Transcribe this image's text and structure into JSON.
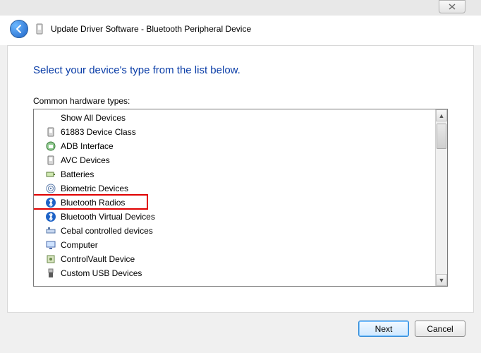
{
  "window": {
    "title": "Update Driver Software - Bluetooth Peripheral Device"
  },
  "instruction": "Select your device's type from the list below.",
  "list_label": "Common hardware types:",
  "items": [
    {
      "label": "Show All Devices",
      "icon": ""
    },
    {
      "label": "61883 Device Class",
      "icon": "device"
    },
    {
      "label": "ADB Interface",
      "icon": "adb"
    },
    {
      "label": "AVC Devices",
      "icon": "device"
    },
    {
      "label": "Batteries",
      "icon": "battery"
    },
    {
      "label": "Biometric Devices",
      "icon": "biometric"
    },
    {
      "label": "Bluetooth Radios",
      "icon": "bluetooth"
    },
    {
      "label": "Bluetooth Virtual Devices",
      "icon": "bluetooth"
    },
    {
      "label": "Cebal controlled devices",
      "icon": "cebal"
    },
    {
      "label": "Computer",
      "icon": "computer"
    },
    {
      "label": "ControlVault Device",
      "icon": "vault"
    },
    {
      "label": "Custom USB Devices",
      "icon": "usb"
    }
  ],
  "highlighted_item_index": 6,
  "buttons": {
    "next": "Next",
    "cancel": "Cancel"
  }
}
